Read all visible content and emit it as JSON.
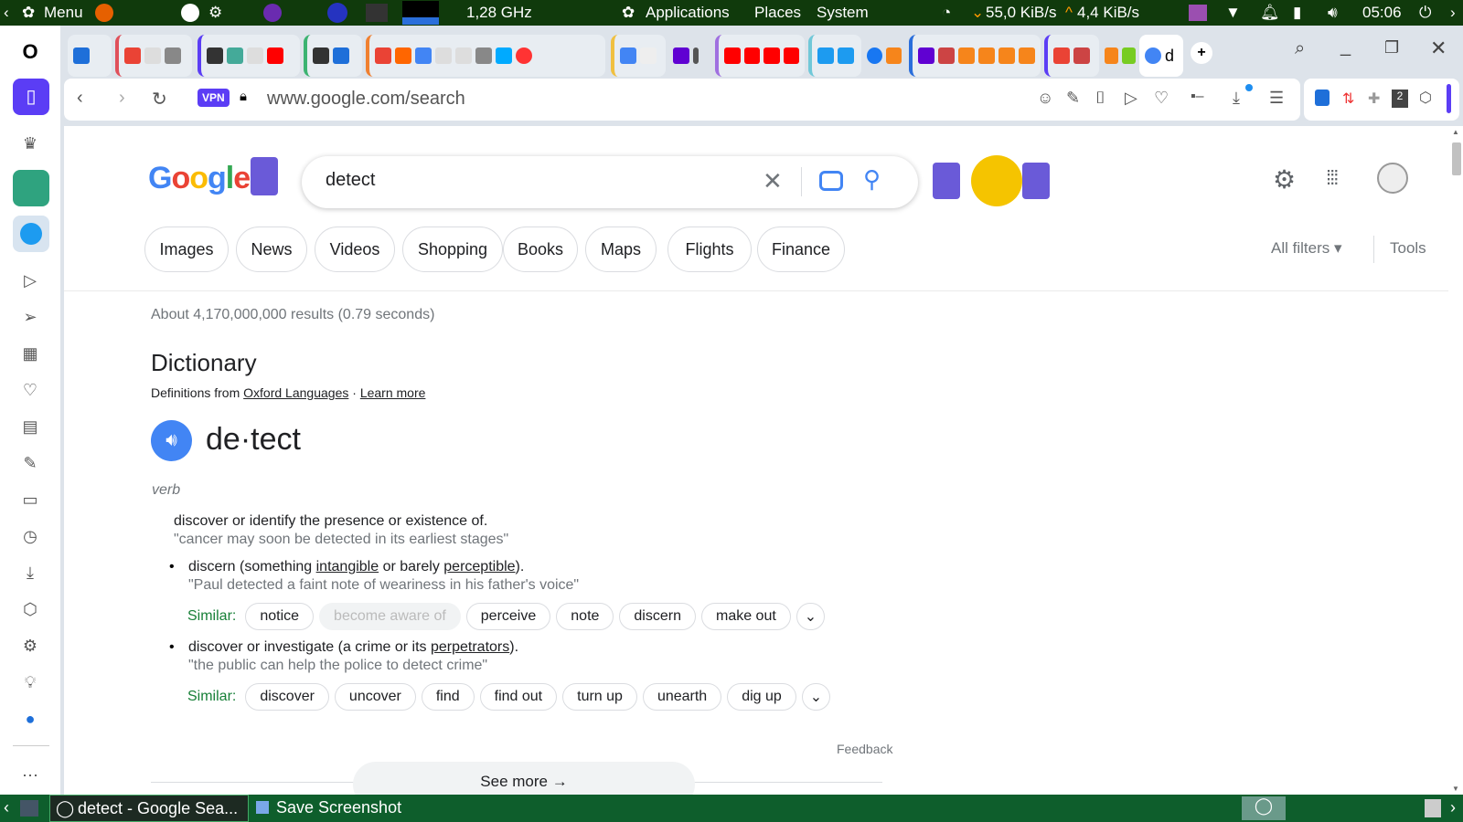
{
  "panel": {
    "menu": "Menu",
    "cpu": "1,28 GHz",
    "applications": "Applications",
    "places": "Places",
    "system": "System",
    "down": "55,0 KiB/s",
    "up": "4,4 KiB/s",
    "time": "05:06"
  },
  "browser": {
    "vpn": "VPN",
    "url": "www.google.com/search",
    "active_tab_letter": "d"
  },
  "search": {
    "query": "detect"
  },
  "chips": [
    "Images",
    "News",
    "Videos",
    "Shopping",
    "Books",
    "Maps",
    "Flights",
    "Finance"
  ],
  "filters": {
    "all": "All filters",
    "tools": "Tools"
  },
  "stats": "About 4,170,000,000 results (0.79 seconds)",
  "dict": {
    "title": "Dictionary",
    "from": "Definitions from",
    "oxford": "Oxford Languages",
    "sep": "·",
    "learn": "Learn more",
    "word": "de·tect",
    "pos": "verb",
    "def1": "discover or identify the presence or existence of.",
    "ex1": "\"cancer may soon be detected in its earliest stages\"",
    "def2a": "discern (something ",
    "def2b": "intangible",
    "def2c": " or barely ",
    "def2d": "perceptible",
    "def2e": ").",
    "ex2": "\"Paul detected a faint note of weariness in his father's voice\"",
    "similar": "Similar:",
    "sim1": [
      "notice",
      "become aware of",
      "perceive",
      "note",
      "discern",
      "make out"
    ],
    "def3a": "discover or investigate (a crime or its ",
    "def3b": "perpetrators",
    "def3c": ").",
    "ex3": "\"the public can help the police to detect crime\"",
    "sim2": [
      "discover",
      "uncover",
      "find",
      "find out",
      "turn up",
      "unearth",
      "dig up"
    ],
    "feedback": "Feedback",
    "see_more": "See more"
  },
  "taskbar": {
    "task1": "detect - Google Sea...",
    "task2": "Save Screenshot"
  },
  "colors": {
    "panel": "#103a0c",
    "taskbar": "#0e5e2c",
    "accent": "#5b3df5",
    "blue": "#4285f4",
    "green": "#188038"
  }
}
